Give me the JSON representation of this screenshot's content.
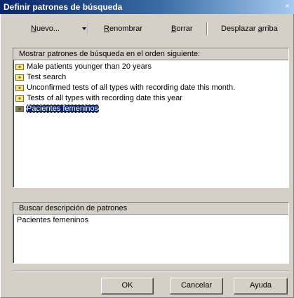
{
  "window": {
    "title": "Definir patrones de búsqueda",
    "close_symbol": "×"
  },
  "toolbar": {
    "nuevo_label": "Nuevo...",
    "nuevo_mnemonic": "N",
    "nuevo_rest": "uevo...",
    "renombrar_mnemonic": "R",
    "renombrar_rest": "enombrar",
    "borrar_mnemonic": "B",
    "borrar_rest": "orrar",
    "desplazar_pre": "Desplazar ",
    "desplazar_mnemonic": "a",
    "desplazar_post": "rriba"
  },
  "patterns_list": {
    "header": "Mostrar patrones de búsqueda en el orden siguiente:",
    "items": [
      {
        "label": "Male patients younger than 20 years",
        "icon": "pattern-icon",
        "selected": false
      },
      {
        "label": "Test search",
        "icon": "pattern-icon",
        "selected": false
      },
      {
        "label": "Unconfirmed tests of all types with recording date this month.",
        "icon": "pattern-icon",
        "selected": false
      },
      {
        "label": "Tests of all types with recording date this year",
        "icon": "pattern-icon",
        "selected": false
      },
      {
        "label": "Pacientes femeninos",
        "icon": "pattern-icon",
        "selected": true
      }
    ]
  },
  "description": {
    "header": "Buscar descripción de patrones",
    "text": "Pacientes femeninos"
  },
  "buttons": {
    "ok": "OK",
    "cancel": "Cancelar",
    "help": "Ayuda"
  },
  "colors": {
    "dialog_bg": "#d4d0c8",
    "title_start": "#0a246a",
    "title_end": "#a6caf0",
    "selection": "#0a246a",
    "pattern_icon_fill": "#f4e58a",
    "pattern_icon_selected_fill": "#7f7f5a"
  }
}
